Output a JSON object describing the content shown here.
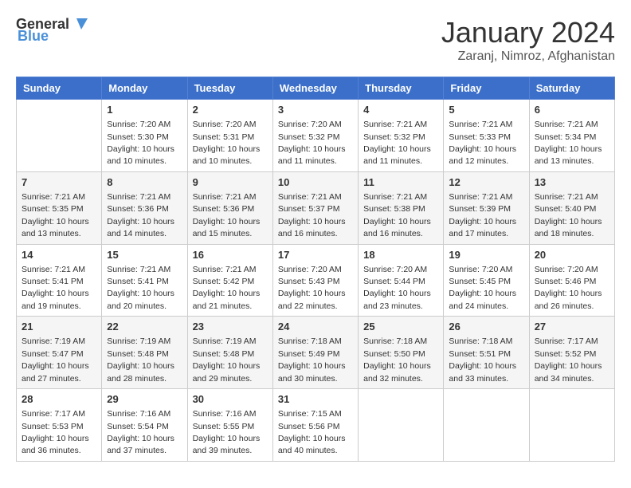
{
  "header": {
    "logo_general": "General",
    "logo_blue": "Blue",
    "month_title": "January 2024",
    "location": "Zaranj, Nimroz, Afghanistan"
  },
  "weekdays": [
    "Sunday",
    "Monday",
    "Tuesday",
    "Wednesday",
    "Thursday",
    "Friday",
    "Saturday"
  ],
  "weeks": [
    [
      {
        "day": "",
        "info": ""
      },
      {
        "day": "1",
        "info": "Sunrise: 7:20 AM\nSunset: 5:30 PM\nDaylight: 10 hours\nand 10 minutes."
      },
      {
        "day": "2",
        "info": "Sunrise: 7:20 AM\nSunset: 5:31 PM\nDaylight: 10 hours\nand 10 minutes."
      },
      {
        "day": "3",
        "info": "Sunrise: 7:20 AM\nSunset: 5:32 PM\nDaylight: 10 hours\nand 11 minutes."
      },
      {
        "day": "4",
        "info": "Sunrise: 7:21 AM\nSunset: 5:32 PM\nDaylight: 10 hours\nand 11 minutes."
      },
      {
        "day": "5",
        "info": "Sunrise: 7:21 AM\nSunset: 5:33 PM\nDaylight: 10 hours\nand 12 minutes."
      },
      {
        "day": "6",
        "info": "Sunrise: 7:21 AM\nSunset: 5:34 PM\nDaylight: 10 hours\nand 13 minutes."
      }
    ],
    [
      {
        "day": "7",
        "info": "Sunrise: 7:21 AM\nSunset: 5:35 PM\nDaylight: 10 hours\nand 13 minutes."
      },
      {
        "day": "8",
        "info": "Sunrise: 7:21 AM\nSunset: 5:36 PM\nDaylight: 10 hours\nand 14 minutes."
      },
      {
        "day": "9",
        "info": "Sunrise: 7:21 AM\nSunset: 5:36 PM\nDaylight: 10 hours\nand 15 minutes."
      },
      {
        "day": "10",
        "info": "Sunrise: 7:21 AM\nSunset: 5:37 PM\nDaylight: 10 hours\nand 16 minutes."
      },
      {
        "day": "11",
        "info": "Sunrise: 7:21 AM\nSunset: 5:38 PM\nDaylight: 10 hours\nand 16 minutes."
      },
      {
        "day": "12",
        "info": "Sunrise: 7:21 AM\nSunset: 5:39 PM\nDaylight: 10 hours\nand 17 minutes."
      },
      {
        "day": "13",
        "info": "Sunrise: 7:21 AM\nSunset: 5:40 PM\nDaylight: 10 hours\nand 18 minutes."
      }
    ],
    [
      {
        "day": "14",
        "info": "Sunrise: 7:21 AM\nSunset: 5:41 PM\nDaylight: 10 hours\nand 19 minutes."
      },
      {
        "day": "15",
        "info": "Sunrise: 7:21 AM\nSunset: 5:41 PM\nDaylight: 10 hours\nand 20 minutes."
      },
      {
        "day": "16",
        "info": "Sunrise: 7:21 AM\nSunset: 5:42 PM\nDaylight: 10 hours\nand 21 minutes."
      },
      {
        "day": "17",
        "info": "Sunrise: 7:20 AM\nSunset: 5:43 PM\nDaylight: 10 hours\nand 22 minutes."
      },
      {
        "day": "18",
        "info": "Sunrise: 7:20 AM\nSunset: 5:44 PM\nDaylight: 10 hours\nand 23 minutes."
      },
      {
        "day": "19",
        "info": "Sunrise: 7:20 AM\nSunset: 5:45 PM\nDaylight: 10 hours\nand 24 minutes."
      },
      {
        "day": "20",
        "info": "Sunrise: 7:20 AM\nSunset: 5:46 PM\nDaylight: 10 hours\nand 26 minutes."
      }
    ],
    [
      {
        "day": "21",
        "info": "Sunrise: 7:19 AM\nSunset: 5:47 PM\nDaylight: 10 hours\nand 27 minutes."
      },
      {
        "day": "22",
        "info": "Sunrise: 7:19 AM\nSunset: 5:48 PM\nDaylight: 10 hours\nand 28 minutes."
      },
      {
        "day": "23",
        "info": "Sunrise: 7:19 AM\nSunset: 5:48 PM\nDaylight: 10 hours\nand 29 minutes."
      },
      {
        "day": "24",
        "info": "Sunrise: 7:18 AM\nSunset: 5:49 PM\nDaylight: 10 hours\nand 30 minutes."
      },
      {
        "day": "25",
        "info": "Sunrise: 7:18 AM\nSunset: 5:50 PM\nDaylight: 10 hours\nand 32 minutes."
      },
      {
        "day": "26",
        "info": "Sunrise: 7:18 AM\nSunset: 5:51 PM\nDaylight: 10 hours\nand 33 minutes."
      },
      {
        "day": "27",
        "info": "Sunrise: 7:17 AM\nSunset: 5:52 PM\nDaylight: 10 hours\nand 34 minutes."
      }
    ],
    [
      {
        "day": "28",
        "info": "Sunrise: 7:17 AM\nSunset: 5:53 PM\nDaylight: 10 hours\nand 36 minutes."
      },
      {
        "day": "29",
        "info": "Sunrise: 7:16 AM\nSunset: 5:54 PM\nDaylight: 10 hours\nand 37 minutes."
      },
      {
        "day": "30",
        "info": "Sunrise: 7:16 AM\nSunset: 5:55 PM\nDaylight: 10 hours\nand 39 minutes."
      },
      {
        "day": "31",
        "info": "Sunrise: 7:15 AM\nSunset: 5:56 PM\nDaylight: 10 hours\nand 40 minutes."
      },
      {
        "day": "",
        "info": ""
      },
      {
        "day": "",
        "info": ""
      },
      {
        "day": "",
        "info": ""
      }
    ]
  ]
}
